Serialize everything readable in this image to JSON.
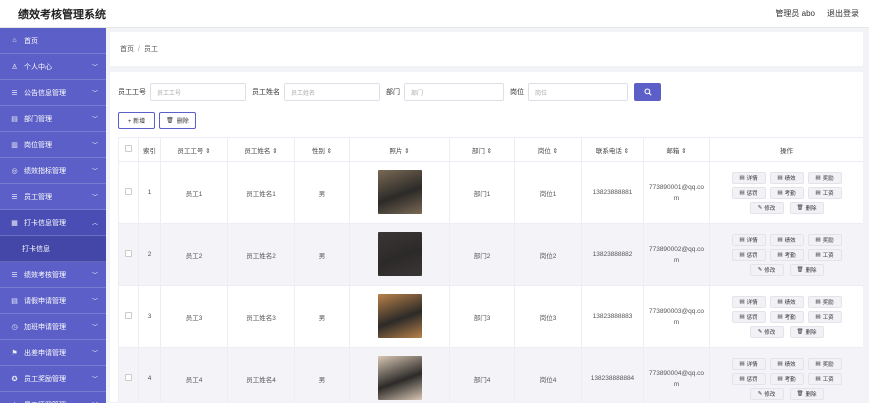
{
  "header": {
    "title": "绩效考核管理系统",
    "admin": "管理员 abo",
    "logout": "退出登录"
  },
  "sidebar": {
    "items": [
      {
        "label": "首页",
        "icon": "home-icon",
        "has_arrow": false
      },
      {
        "label": "个人中心",
        "icon": "user-icon",
        "has_arrow": true
      },
      {
        "label": "公告信息管理",
        "icon": "list-icon",
        "has_arrow": true
      },
      {
        "label": "部门管理",
        "icon": "folder-icon",
        "has_arrow": true
      },
      {
        "label": "岗位管理",
        "icon": "briefcase-icon",
        "has_arrow": true
      },
      {
        "label": "绩效指标管理",
        "icon": "target-icon",
        "has_arrow": true
      },
      {
        "label": "员工管理",
        "icon": "list-icon",
        "has_arrow": true
      },
      {
        "label": "打卡信息管理",
        "icon": "calendar-icon",
        "has_arrow": true,
        "expanded": true
      }
    ],
    "sub_item": "打卡信息",
    "items_after": [
      {
        "label": "绩效考核管理",
        "icon": "list-icon",
        "has_arrow": true
      },
      {
        "label": "请假申请管理",
        "icon": "doc-icon",
        "has_arrow": true
      },
      {
        "label": "加班申请管理",
        "icon": "clock-icon",
        "has_arrow": true
      },
      {
        "label": "出差申请管理",
        "icon": "flag-icon",
        "has_arrow": true
      },
      {
        "label": "员工奖励管理",
        "icon": "award-icon",
        "has_arrow": true
      },
      {
        "label": "员工惩罚管理",
        "icon": "warning-icon",
        "has_arrow": true
      }
    ]
  },
  "breadcrumb": {
    "home": "首页",
    "sep": "/",
    "current": "员工"
  },
  "search": {
    "fields": [
      {
        "label": "员工工号",
        "placeholder": "员工工号"
      },
      {
        "label": "员工姓名",
        "placeholder": "员工姓名"
      },
      {
        "label": "部门",
        "placeholder": "部门"
      },
      {
        "label": "岗位",
        "placeholder": "岗位"
      }
    ],
    "button_icon": "search-icon"
  },
  "actions": {
    "add": "+ 新增",
    "delete": "删除"
  },
  "table": {
    "columns": [
      "索引",
      "员工工号",
      "员工姓名",
      "性别",
      "照片",
      "部门",
      "岗位",
      "联系电话",
      "邮箱",
      "操作"
    ],
    "sort_glyph": "⇕",
    "ops": [
      "详情",
      "绩效",
      "奖励",
      "惩罚",
      "考勤",
      "工资",
      "修改",
      "删除"
    ],
    "rows": [
      {
        "index": "1",
        "no": "员工1",
        "name": "员工姓名1",
        "gender": "男",
        "dept": "部门1",
        "post": "岗位1",
        "phone": "13823888881",
        "email": "773890001@qq.com",
        "photo_color": "#7a6a55"
      },
      {
        "index": "2",
        "no": "员工2",
        "name": "员工姓名2",
        "gender": "男",
        "dept": "部门2",
        "post": "岗位2",
        "phone": "13823888882",
        "email": "773890002@qq.com",
        "photo_color": "#3a3636"
      },
      {
        "index": "3",
        "no": "员工3",
        "name": "员工姓名3",
        "gender": "男",
        "dept": "部门3",
        "post": "岗位3",
        "phone": "13823888883",
        "email": "773890003@qq.com",
        "photo_color": "#b9824a"
      },
      {
        "index": "4",
        "no": "员工4",
        "name": "员工姓名4",
        "gender": "男",
        "dept": "部门4",
        "post": "岗位4",
        "phone": "138238888884",
        "email": "773890004@qq.com",
        "photo_color": "#d8c7b4"
      }
    ]
  },
  "colors": {
    "primary": "#5b5fc7",
    "sidebar_active": "#4447a8"
  }
}
